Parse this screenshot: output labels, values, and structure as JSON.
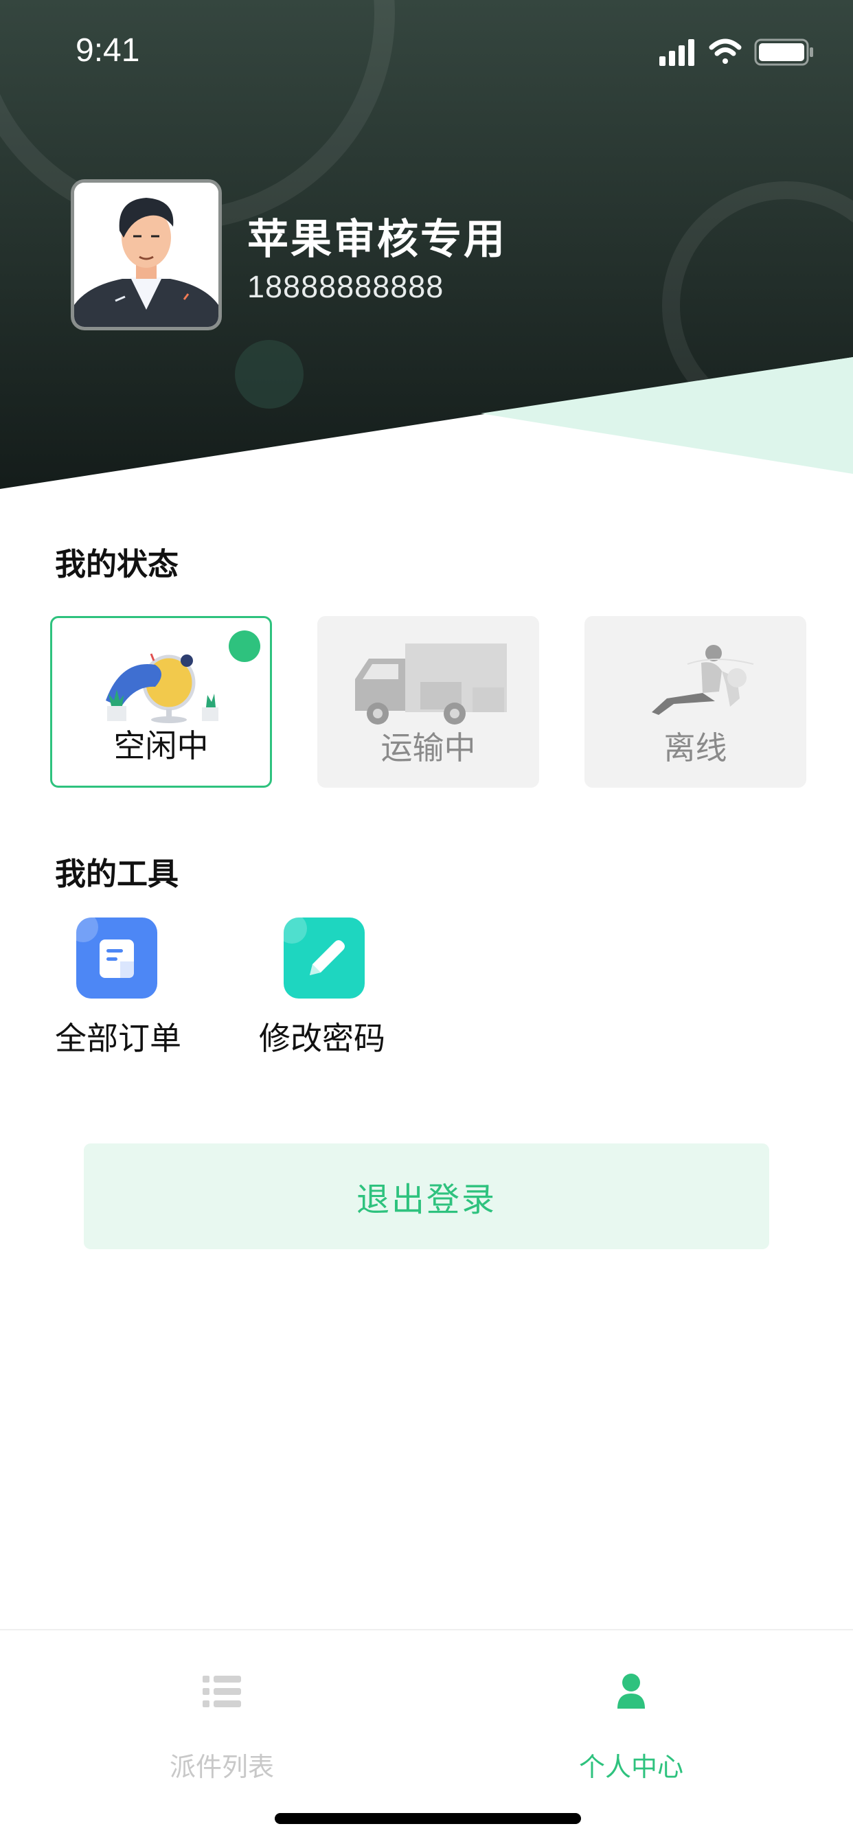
{
  "status_bar": {
    "time": "9:41"
  },
  "profile": {
    "name": "苹果审核专用",
    "phone": "18888888888"
  },
  "my_status": {
    "title": "我的状态",
    "options": [
      {
        "label": "空闲中",
        "selected": true
      },
      {
        "label": "运输中",
        "selected": false
      },
      {
        "label": "离线",
        "selected": false
      }
    ]
  },
  "my_tools": {
    "title": "我的工具",
    "items": [
      {
        "label": "全部订单",
        "icon": "document-icon",
        "color": "#4d87f5"
      },
      {
        "label": "修改密码",
        "icon": "pencil-icon",
        "color": "#1ed6c0"
      }
    ]
  },
  "logout_label": "退出登录",
  "tabs": [
    {
      "label": "派件列表",
      "icon": "list-icon",
      "active": false
    },
    {
      "label": "个人中心",
      "icon": "person-icon",
      "active": true
    }
  ],
  "colors": {
    "accent": "#2ec27e",
    "header_dark": "#1c2a27",
    "inactive_tab": "#c8c8c8"
  }
}
